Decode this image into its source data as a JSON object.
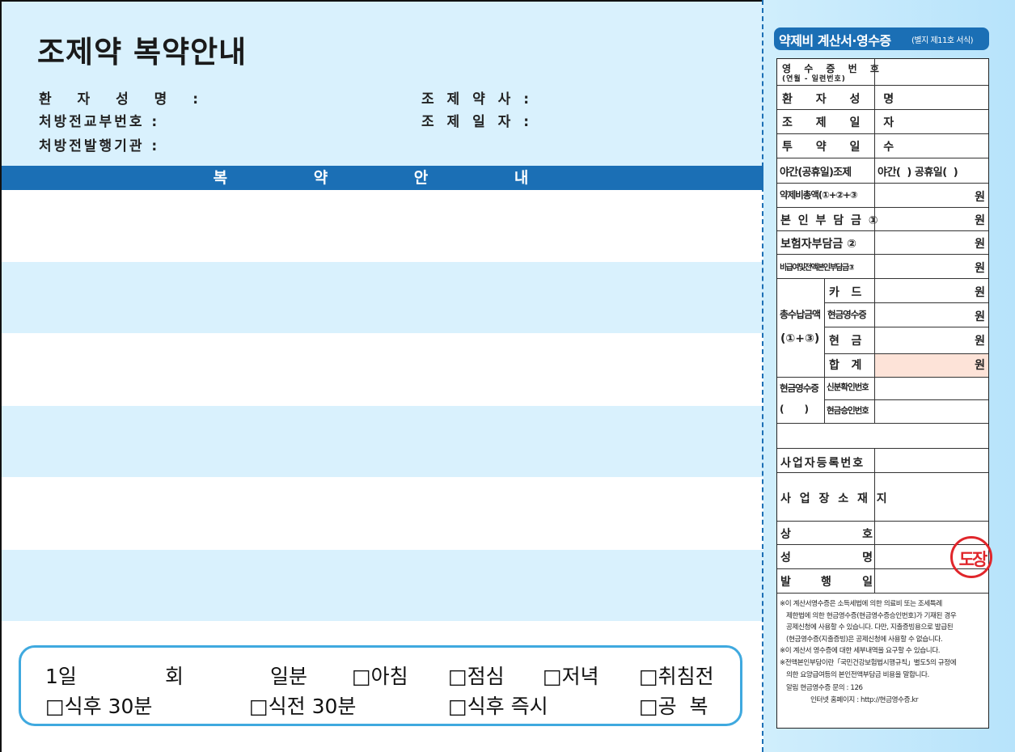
{
  "prescription_guide": {
    "title": "조제약 복약안내",
    "patient_name_label": "환 자 성 명 :",
    "prescription_no_label": "처방전교부번호 :",
    "issuing_institution_label": "처방전발행기관 :",
    "pharmacist_label": "조 제 약 사 :",
    "dispense_date_label": "조 제 일 자 :",
    "section_title": "복 약 안 내",
    "dosage": {
      "per_day": "1일",
      "times": "회",
      "days": "일분",
      "morning": "□아침",
      "lunch": "□점심",
      "evening": "□저녁",
      "bedtime": "□취침전",
      "after_meal_30": "□식후 30분",
      "before_meal_30": "□식전 30분",
      "right_after_meal": "□식후 즉시",
      "empty_stomach": "□공  복"
    }
  },
  "receipt": {
    "title": "약제비 계산서·영수증",
    "form_note": "(별지 제11호 서식)",
    "receipt_no_label": "영 수 증 번 호",
    "receipt_no_sub": "(연월 - 일련번호)",
    "patient_label": "환 자 성 명",
    "dispense_date_label": "조 제 일 자",
    "dose_days_label": "투 약 일 수",
    "night_holiday_label": "야간(공휴일)조제",
    "night_holiday_value": "야간(  ) 공휴일(  )",
    "total_cost_label": "약제비총액(①+②+③",
    "self_pay_label": "본 인 부 담 금 ①",
    "insurer_pay_label": "보험자부담금 ②",
    "non_covered_label": "비급여및전액본인부담금③",
    "total_paid_label_1": "총수납금액",
    "total_paid_label_2": "(①+③)",
    "card_label": "카   드",
    "cash_receipt_label": "현금영수증",
    "cash_label": "현   금",
    "sum_label": "합   계",
    "won": "원",
    "cash_receipt_block_label": "현금영수증",
    "cash_receipt_block_paren": "(      )",
    "id_check_no_label": "신분확인번호",
    "approval_no_label": "현금승인번호",
    "biz_reg_no_label": "사업자등록번호",
    "biz_address_label": "사 업 장 소 재 지",
    "trade_name_label": "상   호",
    "name_label": "성   명",
    "issue_date_label": "발   행   일",
    "stamp_text": "도장",
    "notes": [
      "※이 계산서영수증은 소득세법에 의한 의료비 또는 조세특례",
      "  제한법에 의한 현금영수증(현금영수증승인번호)가 기재된 경우",
      "  공제신청에 사용할 수 있습니다. 다만, 지출증빙용으로 발급된",
      "  (현금영수증(지출증빙)은 공제신청에 사용할 수 없습니다.",
      "※이 계산서 영수증에 대한 세부내역을 요구할 수 있습니다.",
      "※전액본인부담이란「국민건강보험법시행규칙」별도5의 규정에",
      "  의한 요양급여등의 본인전액부담금 비용을 말합니다."
    ],
    "contact_1": "알림   현금영수증 문의 : 126",
    "contact_2": "인터넷 홈페이지 : http://현금영수증.kr"
  },
  "colors": {
    "header_blue": "#1b6fb5",
    "light_blue": "#d9f1fd",
    "dose_border": "#3fa9df",
    "stamp_red": "#e0262b",
    "total_pink": "#fde3d8"
  }
}
